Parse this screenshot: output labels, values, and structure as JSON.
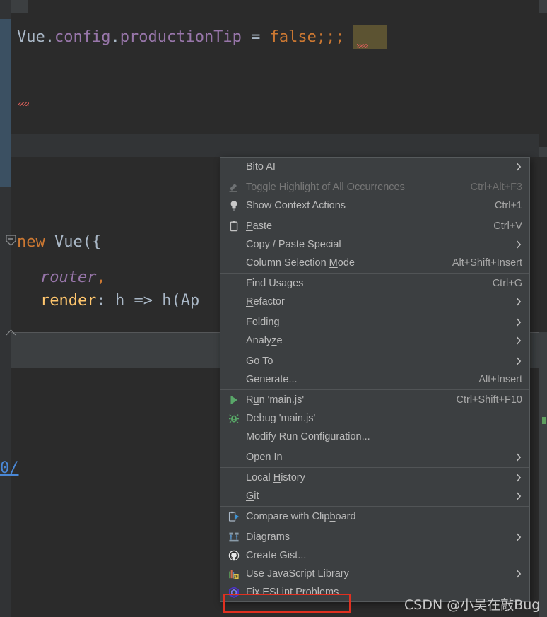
{
  "editor": {
    "code_lines": [
      {
        "id": "line1",
        "text": "Vue.config.productionTip = false;;;"
      },
      {
        "id": "line2",
        "text": "new Vue({"
      },
      {
        "id": "line3",
        "text": "router,"
      },
      {
        "id": "line4",
        "text": "render: h => h(Ap"
      }
    ],
    "line1_parts": {
      "obj": "Vue",
      "dot1": ".",
      "prop1": "config",
      "dot2": ".",
      "prop2": "productionTip",
      "eq": " = ",
      "value": "false",
      "semi": ";",
      "extra_semis": ";;"
    },
    "line2_parts": {
      "keyword": "new",
      "space": " ",
      "ctor": "Vue",
      "open": "({"
    },
    "line3_parts": {
      "field": "router",
      "comma": ","
    },
    "line4_parts": {
      "key": "render",
      "colon": ": ",
      "rest": "h => h(Ap"
    },
    "link_fragment": "0/"
  },
  "context_menu": {
    "groups": [
      {
        "items": [
          {
            "label": "Bito AI",
            "shortcut": "",
            "submenu": true,
            "icon": "",
            "disabled": false,
            "mnemonic": ""
          }
        ]
      },
      {
        "items": [
          {
            "label": "Toggle Highlight of All Occurrences",
            "shortcut": "Ctrl+Alt+F3",
            "submenu": false,
            "icon": "marker-pen-icon",
            "disabled": true,
            "mnemonic": ""
          },
          {
            "label": "Show Context Actions",
            "shortcut": "Ctrl+1",
            "submenu": false,
            "icon": "lightbulb-icon",
            "disabled": false,
            "mnemonic": ""
          }
        ]
      },
      {
        "items": [
          {
            "label": "Paste",
            "shortcut": "Ctrl+V",
            "submenu": false,
            "icon": "clipboard-icon",
            "disabled": false,
            "mnemonic": "P"
          },
          {
            "label": "Copy / Paste Special",
            "shortcut": "",
            "submenu": true,
            "icon": "",
            "disabled": false,
            "mnemonic": ""
          },
          {
            "label": "Column Selection Mode",
            "shortcut": "Alt+Shift+Insert",
            "submenu": false,
            "icon": "",
            "disabled": false,
            "mnemonic": "M"
          }
        ]
      },
      {
        "items": [
          {
            "label": "Find Usages",
            "shortcut": "Ctrl+G",
            "submenu": false,
            "icon": "",
            "disabled": false,
            "mnemonic": "U"
          },
          {
            "label": "Refactor",
            "shortcut": "",
            "submenu": true,
            "icon": "",
            "disabled": false,
            "mnemonic": "R"
          }
        ]
      },
      {
        "items": [
          {
            "label": "Folding",
            "shortcut": "",
            "submenu": true,
            "icon": "",
            "disabled": false,
            "mnemonic": ""
          },
          {
            "label": "Analyze",
            "shortcut": "",
            "submenu": true,
            "icon": "",
            "disabled": false,
            "mnemonic": "z"
          }
        ]
      },
      {
        "items": [
          {
            "label": "Go To",
            "shortcut": "",
            "submenu": true,
            "icon": "",
            "disabled": false,
            "mnemonic": ""
          },
          {
            "label": "Generate...",
            "shortcut": "Alt+Insert",
            "submenu": false,
            "icon": "",
            "disabled": false,
            "mnemonic": ""
          }
        ]
      },
      {
        "items": [
          {
            "label": "Run 'main.js'",
            "shortcut": "Ctrl+Shift+F10",
            "submenu": false,
            "icon": "run-play-icon",
            "disabled": false,
            "mnemonic": "u"
          },
          {
            "label": "Debug 'main.js'",
            "shortcut": "",
            "submenu": false,
            "icon": "debug-bug-icon",
            "disabled": false,
            "mnemonic": "D"
          },
          {
            "label": "Modify Run Configuration...",
            "shortcut": "",
            "submenu": false,
            "icon": "",
            "disabled": false,
            "mnemonic": ""
          }
        ]
      },
      {
        "items": [
          {
            "label": "Open In",
            "shortcut": "",
            "submenu": true,
            "icon": "",
            "disabled": false,
            "mnemonic": ""
          }
        ]
      },
      {
        "items": [
          {
            "label": "Local History",
            "shortcut": "",
            "submenu": true,
            "icon": "",
            "disabled": false,
            "mnemonic": "H"
          },
          {
            "label": "Git",
            "shortcut": "",
            "submenu": true,
            "icon": "",
            "disabled": false,
            "mnemonic": "G"
          }
        ]
      },
      {
        "items": [
          {
            "label": "Compare with Clipboard",
            "shortcut": "",
            "submenu": false,
            "icon": "compare-clipboard-icon",
            "disabled": false,
            "mnemonic": "b"
          }
        ]
      },
      {
        "items": [
          {
            "label": "Diagrams",
            "shortcut": "",
            "submenu": true,
            "icon": "diagrams-icon",
            "disabled": false,
            "mnemonic": ""
          },
          {
            "label": "Create Gist...",
            "shortcut": "",
            "submenu": false,
            "icon": "github-icon",
            "disabled": false,
            "mnemonic": ""
          },
          {
            "label": "Use JavaScript Library",
            "shortcut": "",
            "submenu": true,
            "icon": "js-library-icon",
            "disabled": false,
            "mnemonic": ""
          },
          {
            "label": "Fix ESLint Problems",
            "shortcut": "",
            "submenu": false,
            "icon": "eslint-icon",
            "disabled": false,
            "mnemonic": ""
          }
        ]
      }
    ]
  },
  "annotation": {
    "highlighted_item": "Fix ESLint Problems"
  },
  "watermark": {
    "text": "CSDN @小吴在敲Bug"
  },
  "colors": {
    "menu_background": "#3c3f41",
    "editor_background": "#2b2b2b",
    "gutter": "#313335",
    "annotation_red": "#e03020",
    "keyword_orange": "#cc7832",
    "property_purple": "#9876aa",
    "key_yellow": "#ffc66d",
    "text_gray": "#a9b7c6",
    "link_blue": "#4a88d6",
    "change_marker_blue": "#3b5062",
    "selection_olive": "#6d6236"
  }
}
